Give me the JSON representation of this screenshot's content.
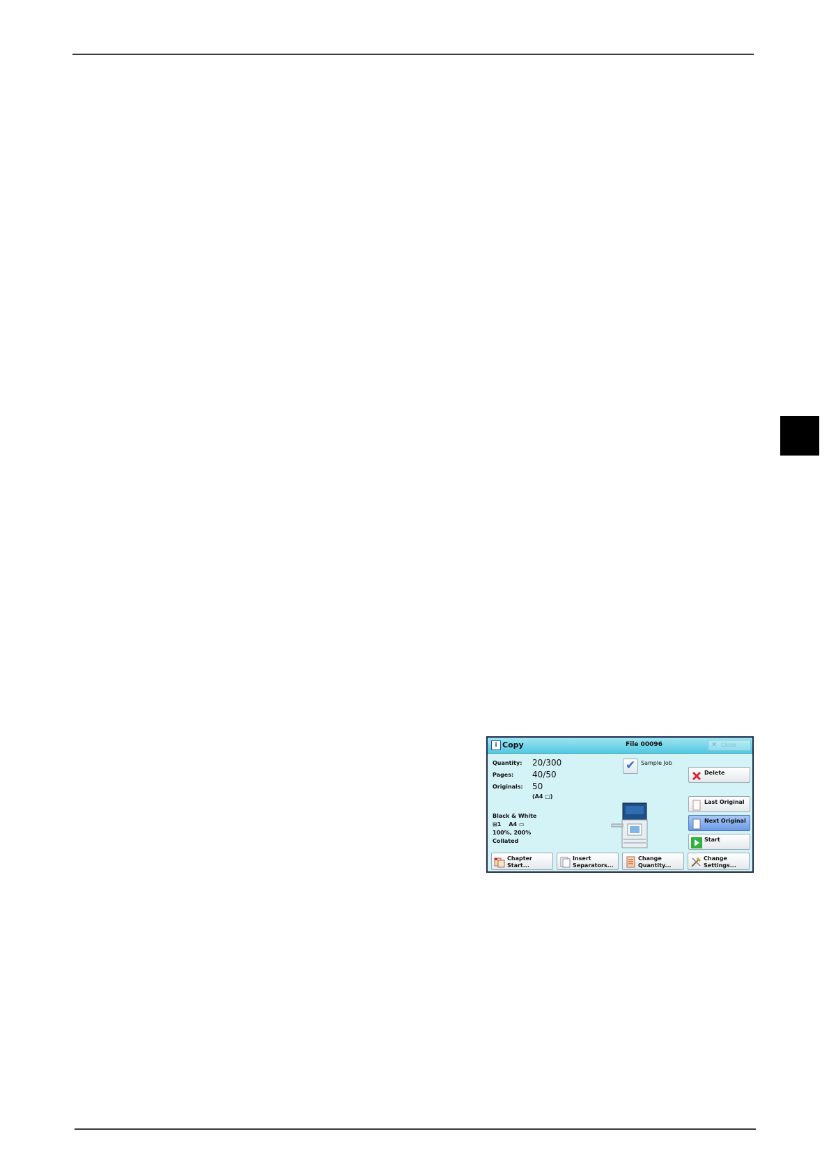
{
  "panel": {
    "title": "Copy",
    "file_name": "File 00096",
    "close_label": "Close",
    "fields": [
      {
        "label": "Quantity:",
        "value": "20/300"
      },
      {
        "label": "Pages:",
        "value": "40/50"
      },
      {
        "label": "Originals:",
        "value": "50"
      }
    ],
    "original_size": "(A4 □)",
    "settings": {
      "color_mode": "Black & White",
      "tray": "⊞1    A4 ▭",
      "reduce_enlarge": "100%, 200%",
      "output": "Collated"
    },
    "sample_job_label": "Sample Job",
    "side_buttons": {
      "delete": "Delete",
      "last_original": "Last Original",
      "next_original": "Next Original",
      "start": "Start"
    },
    "bottom_buttons": {
      "chapter_start": [
        "Chapter Start..."
      ],
      "insert_separators": [
        "Insert",
        "Separators..."
      ],
      "change_quantity": [
        "Change",
        "Quantity..."
      ],
      "change_settings": [
        "Change",
        "Settings..."
      ]
    },
    "colors": {
      "panel_bg": "#d3f3f7",
      "titlebar": "#53c8e0",
      "active_button": "#6d9be6",
      "delete_icon": "#d9232d",
      "start_icon": "#2fb13b"
    },
    "icons": [
      "info-icon",
      "close-icon",
      "checkmark-icon",
      "delete-icon",
      "page-icon",
      "play-icon",
      "chapter-icon",
      "separator-icon",
      "quantity-icon",
      "settings-icon",
      "printer-icon"
    ]
  }
}
